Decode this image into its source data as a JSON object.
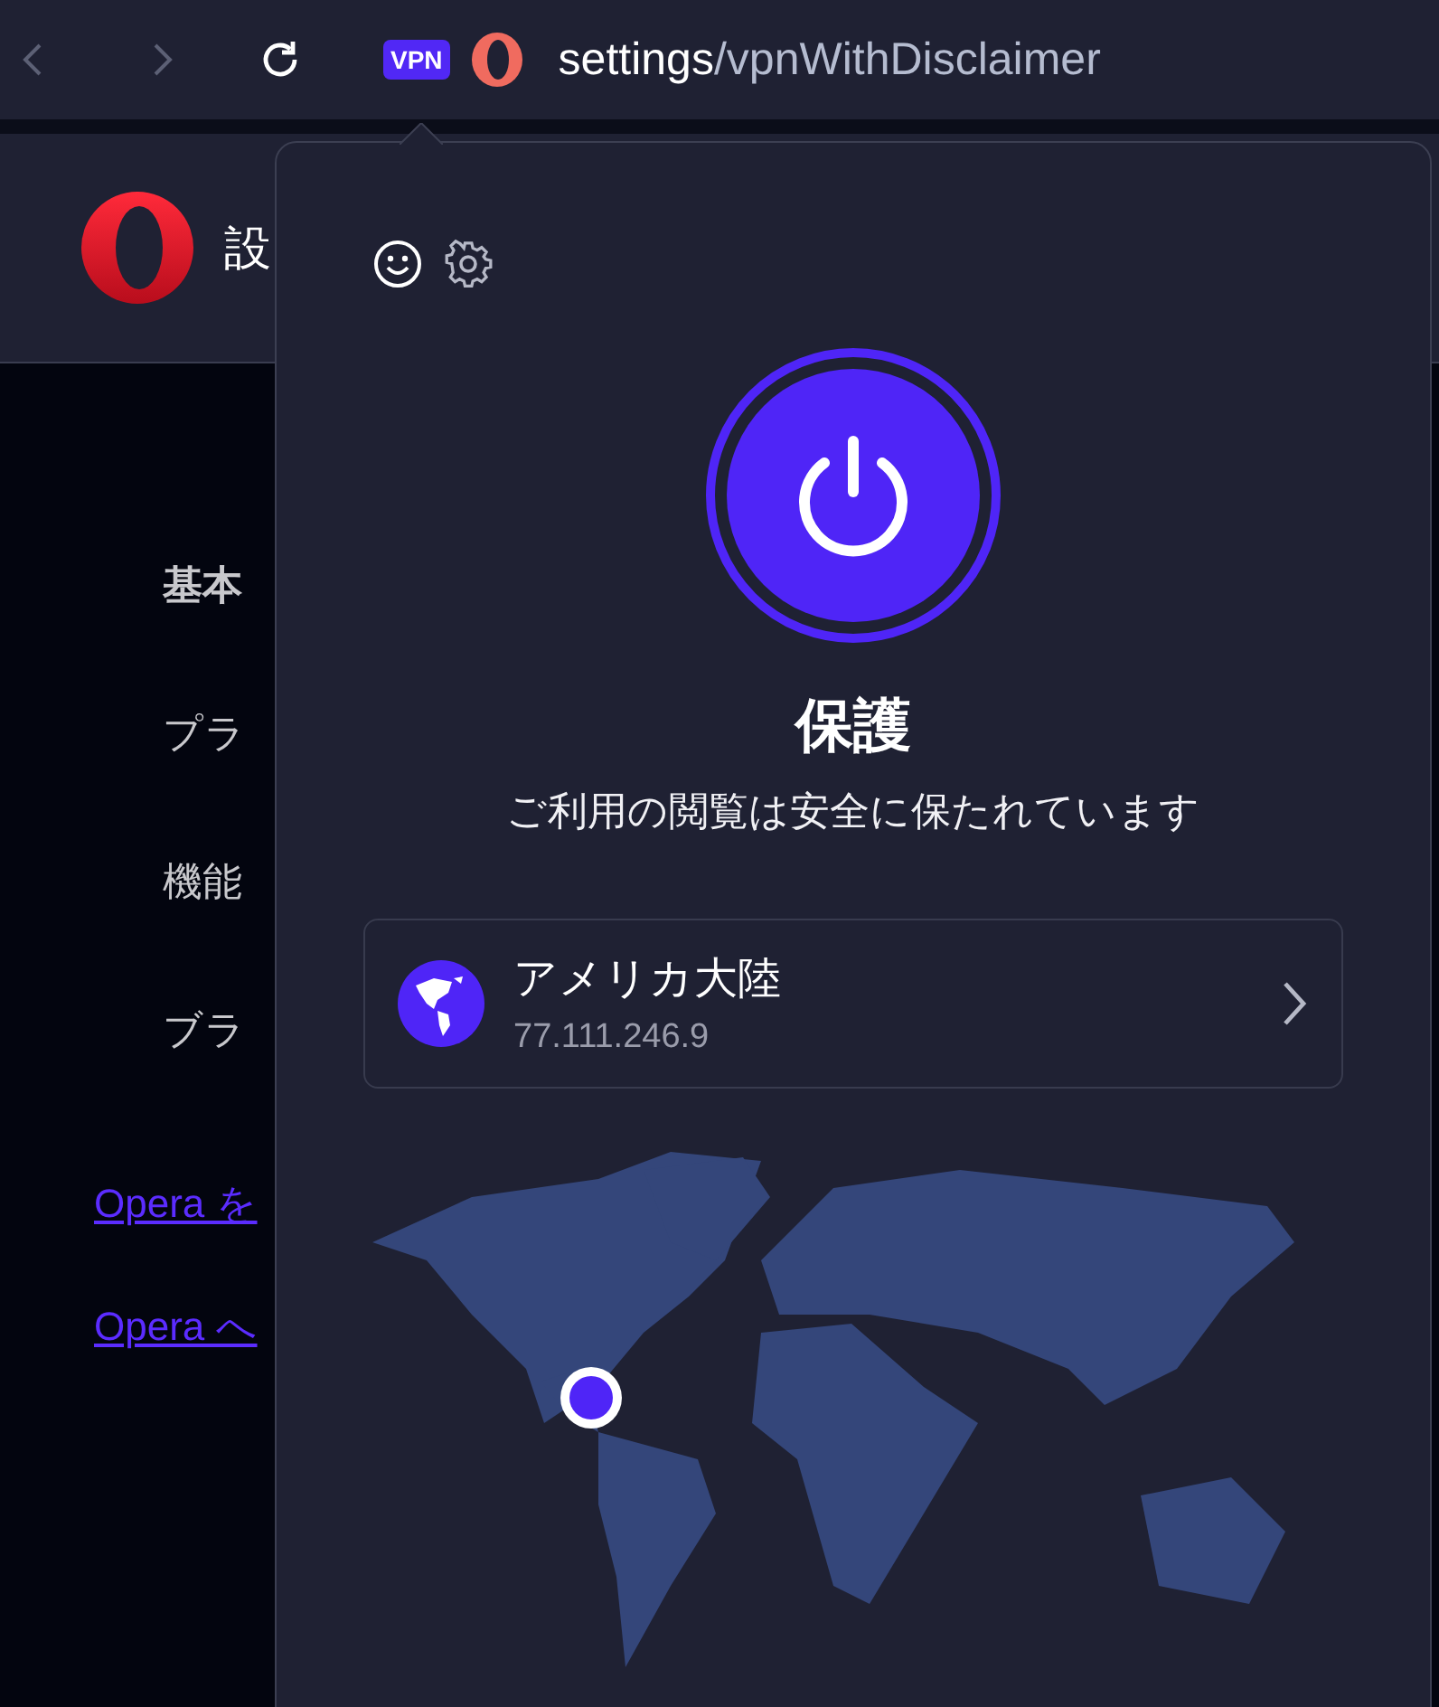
{
  "toolbar": {
    "vpn_badge": "VPN",
    "url_host": "settings",
    "url_path": "/vpnWithDisclaimer",
    "back_disabled": true,
    "forward_disabled": true
  },
  "page": {
    "heading": "設",
    "sections": [
      {
        "label": "基本",
        "bold": true
      },
      {
        "label": "プラ",
        "bold": false
      },
      {
        "label": "機能",
        "bold": false
      },
      {
        "label": "ブラ",
        "bold": false
      }
    ],
    "links": [
      "Opera を",
      "Opera へ"
    ]
  },
  "vpn_popup": {
    "on": true,
    "status_title": "保護",
    "status_text": "ご利用の閲覧は安全に保たれています",
    "location": {
      "name": "アメリカ大陸",
      "ip": "77.111.246.9"
    }
  }
}
